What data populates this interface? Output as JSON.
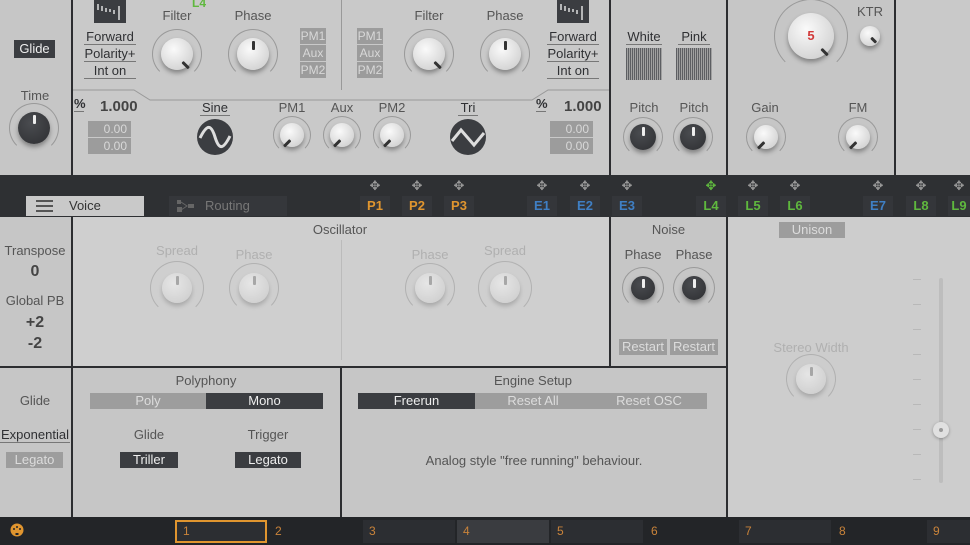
{
  "left": {
    "glide_button": "Glide",
    "time_label": "Time",
    "transpose_label": "Transpose",
    "transpose_value": "0",
    "global_pb_label": "Global PB",
    "pb_up": "+2",
    "pb_down": "-2",
    "glide_label": "Glide",
    "glide_mode": "Exponential",
    "legato_button": "Legato"
  },
  "osc1": {
    "direction": "Forward",
    "polarity": "Polarity+",
    "int": "Int on",
    "filter_label": "Filter",
    "phase_label": "Phase",
    "mod_tag": "L4",
    "mods": [
      "PM1",
      "Aux",
      "PM2"
    ],
    "percent_icon": "%",
    "ratio": "1.000",
    "fine1": "0.00",
    "fine2": "0.00",
    "wave": "Sine",
    "pm1": "PM1",
    "aux": "Aux",
    "pm2": "PM2"
  },
  "osc2": {
    "direction": "Forward",
    "polarity": "Polarity+",
    "int": "Int on",
    "filter_label": "Filter",
    "phase_label": "Phase",
    "mods": [
      "PM1",
      "Aux",
      "PM2"
    ],
    "percent_icon": "%",
    "ratio": "1.000",
    "fine1": "0.00",
    "fine2": "0.00",
    "wave": "Tri"
  },
  "noise_top": {
    "white": "White",
    "pink": "Pink",
    "pitch1": "Pitch",
    "pitch2": "Pitch"
  },
  "filter": {
    "cutoff_value": "5",
    "ktr": "KTR",
    "gain": "Gain",
    "fm": "FM",
    "value_color": "#d23a3a"
  },
  "tabbar": {
    "voice": "Voice",
    "routing": "Routing",
    "mods": [
      {
        "label": "P1",
        "color": "#e0952f"
      },
      {
        "label": "P2",
        "color": "#e0952f"
      },
      {
        "label": "P3",
        "color": "#e0952f"
      },
      {
        "label": "E1",
        "color": "#3f7fc4"
      },
      {
        "label": "E2",
        "color": "#3f7fc4"
      },
      {
        "label": "E3",
        "color": "#3f7fc4"
      },
      {
        "label": "L4",
        "color": "#5fb83e"
      },
      {
        "label": "L5",
        "color": "#5fb83e"
      },
      {
        "label": "L6",
        "color": "#5fb83e"
      },
      {
        "label": "E7",
        "color": "#3f7fc4"
      },
      {
        "label": "L8",
        "color": "#5fb83e"
      },
      {
        "label": "L9",
        "color": "#5fb83e"
      }
    ],
    "move_icon": "move-arrows-icon"
  },
  "oscillator": {
    "title": "Oscillator",
    "spread1": "Spread",
    "phase1": "Phase",
    "phase2": "Phase",
    "spread2": "Spread"
  },
  "noise": {
    "title": "Noise",
    "phase1": "Phase",
    "phase2": "Phase",
    "restart1": "Restart",
    "restart2": "Restart"
  },
  "unison": {
    "button": "Unison",
    "stereo_width": "Stereo Width"
  },
  "polyphony": {
    "title": "Polyphony",
    "poly": "Poly",
    "mono": "Mono",
    "glide_label": "Glide",
    "glide_value": "Triller",
    "trigger_label": "Trigger",
    "trigger_value": "Legato"
  },
  "engine": {
    "title": "Engine Setup",
    "freerun": "Freerun",
    "reset_all": "Reset All",
    "reset_osc": "Reset OSC",
    "description": "Analog style \"free running\" behaviour."
  },
  "footer": {
    "icon": "midi-icon",
    "slots": [
      "1",
      "2",
      "3",
      "4",
      "5",
      "6",
      "7",
      "8",
      "9"
    ],
    "selected": "1",
    "accent": "#e0952f"
  }
}
